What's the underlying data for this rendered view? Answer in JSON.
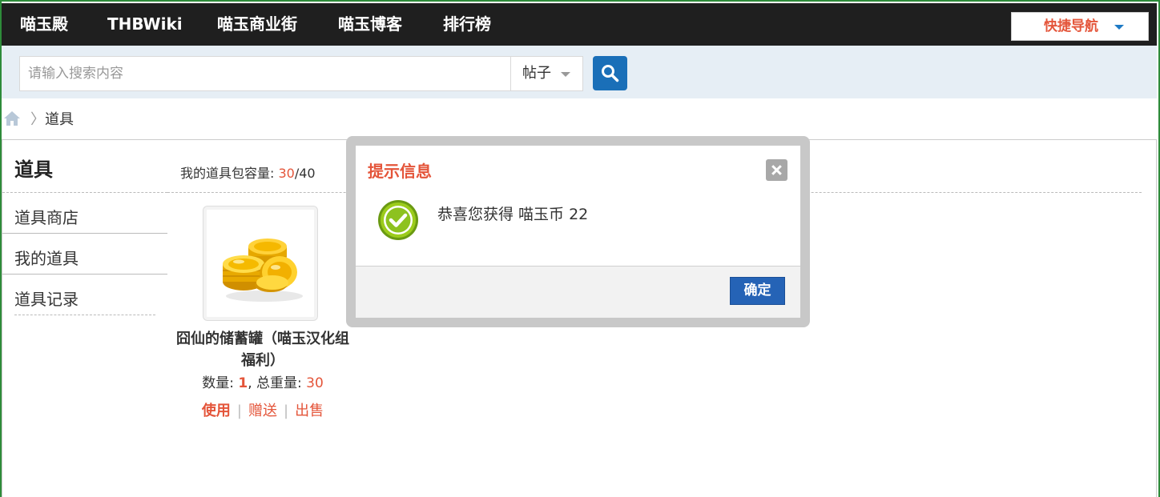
{
  "topnav": {
    "items": [
      "喵玉殿",
      "THBWiki",
      "喵玉商业街",
      "喵玉博客",
      "排行榜"
    ],
    "quicknav_label": "快捷导航"
  },
  "search": {
    "placeholder": "请输入搜索内容",
    "type_label": "帖子"
  },
  "breadcrumb": {
    "separator": "〉",
    "current": "道具"
  },
  "sidebar": {
    "title": "道具",
    "items": [
      "道具商店",
      "我的道具",
      "道具记录"
    ]
  },
  "bag": {
    "capacity_label": "我的道具包容量: ",
    "used": "30",
    "slash": "/",
    "total": "40"
  },
  "item": {
    "name": "囧仙的储蓄罐（喵玉汉化组福利）",
    "quantity_label": "数量: ",
    "quantity": "1",
    "weight_label": ", 总重量: ",
    "weight": "30",
    "actions": {
      "use": "使用",
      "gift": "赠送",
      "sell": "出售"
    },
    "action_sep": "|"
  },
  "modal": {
    "title": "提示信息",
    "message": "恭喜您获得 喵玉币 22",
    "ok_label": "确定"
  },
  "colors": {
    "accent_red": "#e4553a",
    "nav_bg": "#1f1f1f",
    "search_bg": "#e6eef5",
    "button_blue": "#2563b6"
  }
}
